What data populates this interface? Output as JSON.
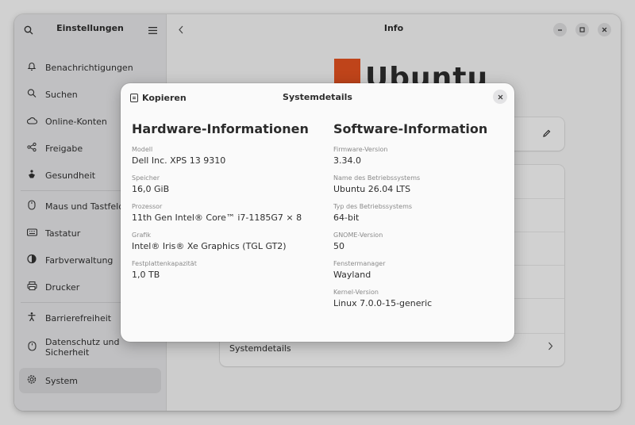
{
  "sidebar": {
    "title": "Einstellungen",
    "search_icon": "search-icon",
    "menu_icon": "hamburger-menu-icon",
    "items": [
      {
        "label": "Benachrichtigungen",
        "icon": "bell-icon"
      },
      {
        "label": "Suchen",
        "icon": "search-icon"
      },
      {
        "label": "Online-Konten",
        "icon": "cloud-icon"
      },
      {
        "label": "Freigabe",
        "icon": "share-icon"
      },
      {
        "label": "Gesundheit",
        "icon": "health-icon"
      },
      {
        "label": "Maus und Tastfeld",
        "icon": "mouse-icon"
      },
      {
        "label": "Tastatur",
        "icon": "keyboard-icon"
      },
      {
        "label": "Farbverwaltung",
        "icon": "color-icon"
      },
      {
        "label": "Drucker",
        "icon": "printer-icon"
      },
      {
        "label": "Barrierefreiheit",
        "icon": "accessibility-icon"
      },
      {
        "label": "Datenschutz und Sicherheit",
        "icon": "privacy-icon"
      },
      {
        "label": "System",
        "icon": "system-icon"
      }
    ]
  },
  "main": {
    "title": "Info",
    "back_icon": "chevron-left-icon",
    "logo_text": "Ubuntu",
    "edit_icon": "pencil-icon",
    "system_details_label": "Systemdetails",
    "system_details_chevron": "chevron-right-icon"
  },
  "window_controls": [
    "minimize",
    "maximize",
    "close"
  ],
  "dialog": {
    "title": "Systemdetails",
    "copy_label": "Kopieren",
    "copy_icon": "copy-icon",
    "close_icon": "close-icon",
    "hardware": {
      "heading": "Hardware-Informationen",
      "fields": [
        {
          "key": "Modell",
          "value": "Dell Inc. XPS 13 9310"
        },
        {
          "key": "Speicher",
          "value": "16,0 GiB"
        },
        {
          "key": "Prozessor",
          "value": "11th Gen Intel® Core™ i7-1185G7 × 8"
        },
        {
          "key": "Grafik",
          "value": "Intel® Iris® Xe Graphics (TGL GT2)"
        },
        {
          "key": "Festplattenkapazität",
          "value": "1,0 TB"
        }
      ]
    },
    "software": {
      "heading": "Software-Information",
      "fields": [
        {
          "key": "Firmware-Version",
          "value": "3.34.0"
        },
        {
          "key": "Name des Betriebssystems",
          "value": "Ubuntu 26.04 LTS"
        },
        {
          "key": "Typ des Betriebssystems",
          "value": "64-bit"
        },
        {
          "key": "GNOME-Version",
          "value": "50"
        },
        {
          "key": "Fenstermanager",
          "value": "Wayland"
        },
        {
          "key": "Kernel-Version",
          "value": "Linux 7.0.0-15-generic"
        }
      ]
    }
  },
  "colors": {
    "accent": "#e95420",
    "sidebar_bg": "#ebebed",
    "dialog_bg": "#fafafa"
  }
}
